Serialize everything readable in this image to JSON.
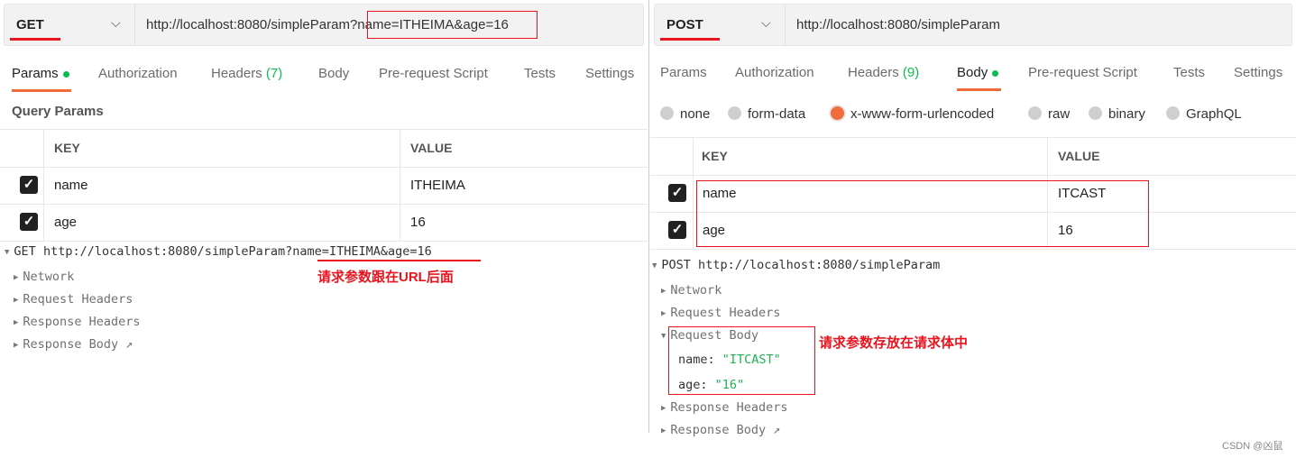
{
  "left": {
    "method": "GET",
    "url_base": "http://localhost:8080/simpleParam",
    "url_query": "?name=ITHEIMA&age=16",
    "tabs": [
      {
        "label": "Params",
        "active": true,
        "dot": true
      },
      {
        "label": "Authorization"
      },
      {
        "label": "Headers",
        "count": "(7)"
      },
      {
        "label": "Body"
      },
      {
        "label": "Pre-request Script"
      },
      {
        "label": "Tests"
      },
      {
        "label": "Settings"
      }
    ],
    "section_title": "Query Params",
    "columns": [
      "KEY",
      "VALUE"
    ],
    "rows": [
      {
        "checked": true,
        "key": "name",
        "value": "ITHEIMA"
      },
      {
        "checked": true,
        "key": "age",
        "value": "16"
      }
    ],
    "console": {
      "line_method": "GET",
      "line_base": "http://localhost:8080/simpleParam",
      "line_query": "?name=ITHEIMA&age=16",
      "items": [
        "Network",
        "Request Headers",
        "Response Headers",
        "Response Body ↗"
      ]
    },
    "annotation": "请求参数跟在URL后面"
  },
  "right": {
    "method": "POST",
    "url": "http://localhost:8080/simpleParam",
    "tabs": [
      {
        "label": "Params"
      },
      {
        "label": "Authorization"
      },
      {
        "label": "Headers",
        "count": "(9)"
      },
      {
        "label": "Body",
        "active": true,
        "dot": true
      },
      {
        "label": "Pre-request Script"
      },
      {
        "label": "Tests"
      },
      {
        "label": "Settings"
      }
    ],
    "body_types": [
      {
        "label": "none"
      },
      {
        "label": "form-data"
      },
      {
        "label": "x-www-form-urlencoded",
        "selected": true
      },
      {
        "label": "raw"
      },
      {
        "label": "binary"
      },
      {
        "label": "GraphQL"
      }
    ],
    "columns": [
      "KEY",
      "VALUE"
    ],
    "rows": [
      {
        "checked": true,
        "key": "name",
        "value": "ITCAST"
      },
      {
        "checked": true,
        "key": "age",
        "value": "16"
      }
    ],
    "console": {
      "line": "POST http://localhost:8080/simpleParam",
      "items_before": [
        "Network",
        "Request Headers"
      ],
      "request_body_label": "Request Body",
      "body_fields": [
        {
          "key": "name:",
          "value": "\"ITCAST\""
        },
        {
          "key": "age:",
          "value": "\"16\""
        }
      ],
      "items_after": [
        "Response Headers",
        "Response Body ↗"
      ]
    },
    "annotation": "请求参数存放在请求体中"
  },
  "watermark": "CSDN @凶鼠",
  "colors": {
    "accent": "#f26b3a",
    "annotation": "#e8141e",
    "success": "#0cbb52"
  }
}
